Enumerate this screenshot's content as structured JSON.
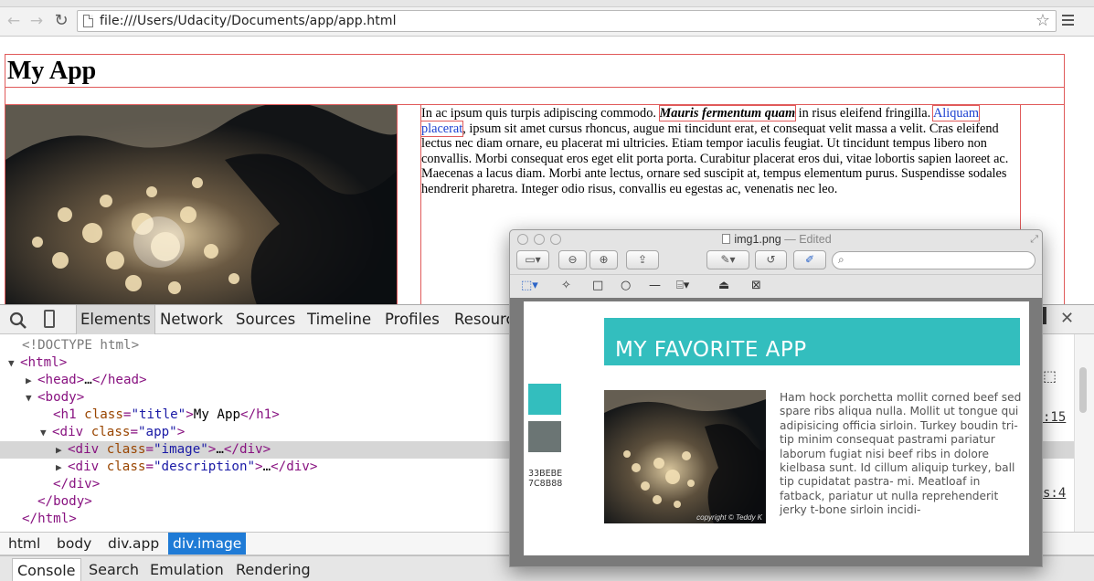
{
  "browser": {
    "url": "file:///Users/Udacity/Documents/app/app.html",
    "back_icon": "back-arrow-icon",
    "forward_icon": "forward-arrow-icon",
    "reload_icon": "reload-icon",
    "star_icon": "bookmark-star-icon",
    "menu_icon": "hamburger-menu-icon"
  },
  "page": {
    "title": "My App",
    "description": {
      "part1": "In ac ipsum quis turpis adipiscing commodo. ",
      "em": "Mauris fermentum quam",
      "part2": " in risus eleifend fringilla. ",
      "link": "Aliquam placerat",
      "part3": ", ipsum sit amet cursus rhoncus, augue mi tincidunt erat, et consequat velit massa a velit. Cras eleifend lectus nec diam ornare, eu placerat mi ultricies. Etiam tempor iaculis feugiat. Ut tincidunt tempus libero non convallis. Morbi consequat eros eget elit porta porta. Curabitur placerat eros dui, vitae lobortis sapien laoreet ac. Maecenas a lacus diam. Morbi ante lectus, ornare sed suscipit at, tempus elementum purus. Suspendisse sodales hendrerit pharetra. Integer odio risus, convallis eu egestas ac, venenatis nec leo."
    }
  },
  "devtools": {
    "tabs": [
      {
        "label": "Elements",
        "active": true
      },
      {
        "label": "Network"
      },
      {
        "label": "Sources"
      },
      {
        "label": "Timeline"
      },
      {
        "label": "Profiles"
      },
      {
        "label": "Resourc"
      }
    ],
    "tree": {
      "doctype": "<!DOCTYPE html>",
      "html_open": "<html>",
      "head": {
        "open": "<head>",
        "ellipsis": "…",
        "close": "</head>"
      },
      "body_open": "<body>",
      "h1": {
        "open": "<h1",
        "attr": "class",
        "val": "\"title\"",
        "close_bracket": ">",
        "text": "My App",
        "end": "</h1>"
      },
      "div_app": {
        "open": "<div",
        "attr": "class",
        "val": "\"app\"",
        "close_bracket": ">"
      },
      "div_image": {
        "open": "<div",
        "attr": "class",
        "val": "\"image\"",
        "close_bracket": ">",
        "ellipsis": "…",
        "end": "</div>"
      },
      "div_desc": {
        "open": "<div",
        "attr": "class",
        "val": "\"description\"",
        "close_bracket": ">",
        "ellipsis": "…",
        "end": "</div>"
      },
      "div_close": "</div>",
      "body_close": "</body>",
      "html_close": "</html>"
    },
    "styles_fragments": [
      ":15",
      "s:4"
    ],
    "breadcrumbs": [
      {
        "label": "html"
      },
      {
        "label": "body"
      },
      {
        "label": "div.app"
      },
      {
        "label": "div.image",
        "active": true
      }
    ],
    "drawer_tabs": [
      {
        "label": "Console",
        "active": true
      },
      {
        "label": "Search"
      },
      {
        "label": "Emulation"
      },
      {
        "label": "Rendering"
      }
    ]
  },
  "preview": {
    "filename": "img1.png",
    "status": " — Edited",
    "mock": {
      "title": "MY FAVORITE APP",
      "swatches": [
        {
          "hex": "33BEBE",
          "color": "#33bebe"
        },
        {
          "hex": "7C8B88",
          "color": "#6b7574"
        }
      ],
      "credit": "copyright © Teddy K",
      "body_text": "Ham hock porchetta mollit corned beef sed spare ribs aliqua nulla. Mollit ut tongue qui adipisicing officia sirloin. Turkey boudin tri-tip minim consequat pastrami pariatur laborum fugiat nisi beef ribs in dolore kielbasa sunt. Id cillum aliquip turkey, ball tip cupidatat pastra- mi. Meatloaf in fatback, pariatur ut nulla reprehenderit jerky t-bone sirloin incidi-"
    }
  },
  "colors": {
    "outline_red": "#e05a5a",
    "link_blue": "#1a3fd0",
    "crumb_active": "#1f7bd6",
    "teal": "#33bebe"
  }
}
